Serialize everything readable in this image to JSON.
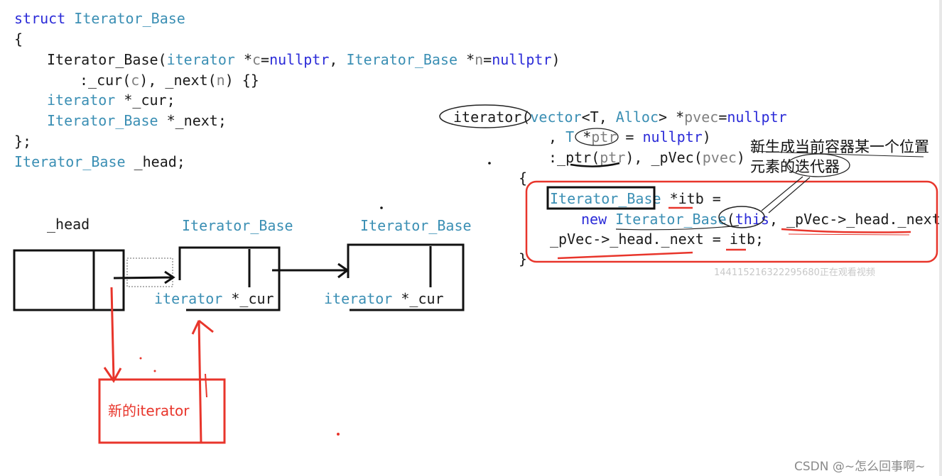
{
  "code_left": {
    "l1_kw": "struct",
    "l1_ty": "Iterator_Base",
    "l2": "{",
    "l3_name": "Iterator_Base(",
    "l3_ty1": "iterator",
    "l3_p1": " *",
    "l3_c": "c",
    "l3_eq1": "=",
    "l3_null1": "nullptr",
    "l3_sep": ", ",
    "l3_ty2": "Iterator_Base",
    "l3_p2": " *",
    "l3_n": "n",
    "l3_eq2": "=",
    "l3_null2": "nullptr",
    "l3_close": ")",
    "l4_a": ":_cur(",
    "l4_c": "c",
    "l4_b": "), _next(",
    "l4_n": "n",
    "l4_e": ") {}",
    "l5_ty": "iterator",
    "l5_rest": " *_cur;",
    "l6_ty": "Iterator_Base",
    "l6_rest": " *_next;",
    "l7": "};",
    "l8_ty": "Iterator_Base",
    "l8_rest": " _head;"
  },
  "code_right": {
    "r1_a": "iterator",
    "r1_b": "(",
    "r1_ty": "vector",
    "r1_c": "<T, ",
    "r1_alloc": "Alloc",
    "r1_d": "> *",
    "r1_p": "pvec",
    "r1_eq": "=",
    "r1_null": "nullptr",
    "r2_a": ", ",
    "r2_t": "T ",
    "r2_star": "*",
    "r2_p": "ptr",
    "r2_eq": " = ",
    "r2_null": "nullptr",
    "r2_close": ")",
    "r3_a": ":_ptr(",
    "r3_p": "ptr",
    "r3_b": "), _pVec(",
    "r3_pv": "pvec",
    "r3_c": ")",
    "r4": "{",
    "r5_ty": "Iterator_Base",
    "r5_rest": " *itb =",
    "r6_kw": "new",
    "r6_sp": " ",
    "r6_ty": "Iterator_Base",
    "r6_open": "(",
    "r6_this": "this",
    "r6_rest": ", _pVec->_head._next);",
    "r7": "_pVec->_head._next = itb;",
    "r8": "}"
  },
  "annotations": {
    "cn_line1": "新生成当前容器某一个位置",
    "cn_line2": "元素的迭代器",
    "new_iterator": "新的iterator"
  },
  "diagram": {
    "head_label": "_head",
    "node1_label": "Iterator_Base",
    "node2_label": "Iterator_Base",
    "field1_ty": "iterator",
    "field1_rest": " *_cur",
    "field2_ty": "iterator",
    "field2_rest": " *_cur"
  },
  "watermark": "144115216322295680正在观看视频",
  "footer": "CSDN @~怎么回事啊~",
  "colors": {
    "keyword": "#2b2bd8",
    "type": "#3b8fb4",
    "param": "#808080",
    "red_ink": "#e8352b",
    "black_ink": "#111111"
  }
}
